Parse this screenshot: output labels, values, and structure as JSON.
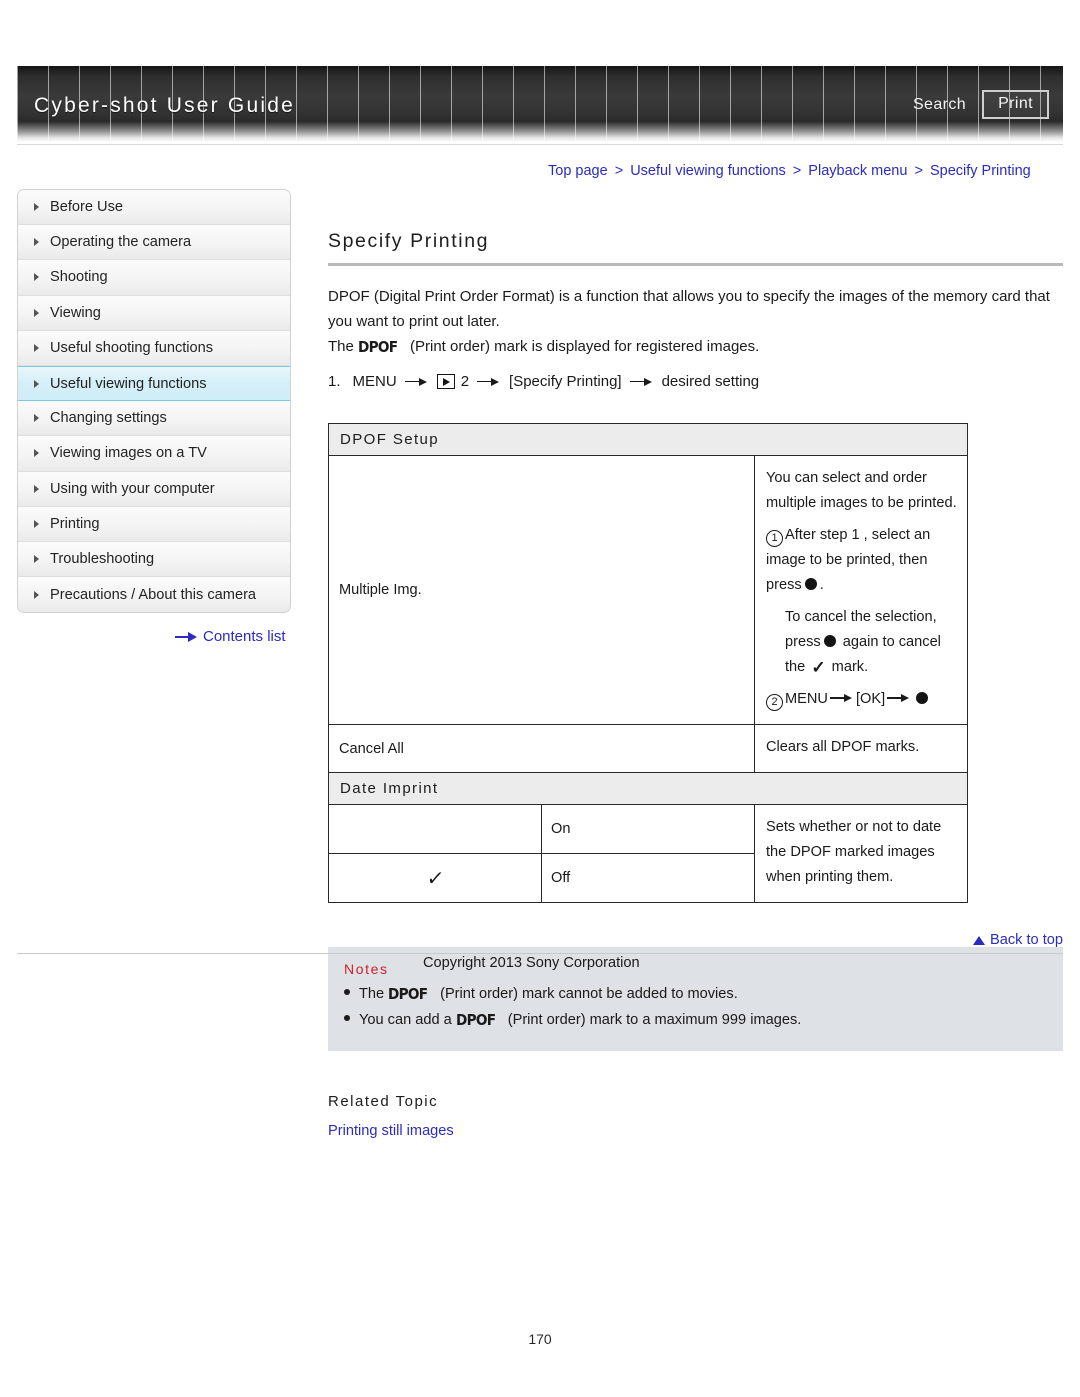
{
  "header": {
    "title": "Cyber-shot User Guide",
    "search_label": "Search",
    "print_label": "Print"
  },
  "breadcrumb": {
    "items": [
      "Top page",
      "Useful viewing functions",
      "Playback menu",
      "Specify Printing"
    ],
    "separator": ">"
  },
  "sidebar": {
    "items": [
      {
        "label": "Before Use",
        "active": false
      },
      {
        "label": "Operating the camera",
        "active": false
      },
      {
        "label": "Shooting",
        "active": false
      },
      {
        "label": "Viewing",
        "active": false
      },
      {
        "label": "Useful shooting functions",
        "active": false
      },
      {
        "label": "Useful viewing functions",
        "active": true
      },
      {
        "label": "Changing settings",
        "active": false
      },
      {
        "label": "Viewing images on a TV",
        "active": false
      },
      {
        "label": "Using with your computer",
        "active": false
      },
      {
        "label": "Printing",
        "active": false
      },
      {
        "label": "Troubleshooting",
        "active": false
      },
      {
        "label": "Precautions / About this camera",
        "active": false
      }
    ],
    "contents_list_label": "Contents list",
    "highlight_color": "#cfeef8",
    "link_color": "#2b2bbf"
  },
  "main": {
    "page_title": "Specify Printing",
    "intro_line1": "DPOF (Digital Print Order Format) is a function that allows you to specify the images of the memory card that you want to print out later.",
    "intro_line2_prefix": "The",
    "dpof_mark": "DPOF",
    "intro_line2_suffix": "(Print order) mark is displayed for registered images.",
    "step": {
      "number": "1.",
      "menu_label": "MENU",
      "menu_index": "2",
      "bracket_item": "[Specify Printing]",
      "result": "desired setting"
    }
  },
  "dpof_setup_table": {
    "section_title": "DPOF Setup",
    "rows": [
      {
        "label": "Multiple Img.",
        "desc_line1": "You can select and order multiple images to be printed.",
        "desc_step1_marker": "1",
        "desc_step1_a": "After step 1 , select an image to be printed, then press",
        "desc_step1_b": ".",
        "desc_step1_cancel_a": "To cancel the selection, press",
        "desc_step1_cancel_b": "again to cancel the",
        "desc_step1_cancel_c": "mark.",
        "desc_step2_marker": "2",
        "desc_step2_a": "MENU",
        "desc_step2_b": "[OK]"
      },
      {
        "label": "Cancel All",
        "desc_line1": "Clears all DPOF marks."
      }
    ]
  },
  "date_imprint_table": {
    "section_title": "Date Imprint",
    "options": [
      {
        "checked": false,
        "label": "On"
      },
      {
        "checked": true,
        "label": "Off"
      }
    ],
    "description": "Sets whether or not to date the DPOF marked images when printing them.",
    "check_glyph": "✓"
  },
  "notes": {
    "title": "Notes",
    "items": [
      {
        "prefix": "The",
        "mark": "DPOF",
        "suffix": "(Print order) mark cannot be added to movies."
      },
      {
        "prefix": "You can add a",
        "mark": "DPOF",
        "suffix": "(Print order) mark to a maximum 999 images."
      }
    ],
    "background": "#dee1e5",
    "title_color": "#d0202a"
  },
  "related": {
    "title": "Related Topic",
    "link": "Printing still images"
  },
  "footer": {
    "back_to_top": "Back to top",
    "copyright": "Copyright 2013 Sony Corporation",
    "page_number": "170"
  }
}
